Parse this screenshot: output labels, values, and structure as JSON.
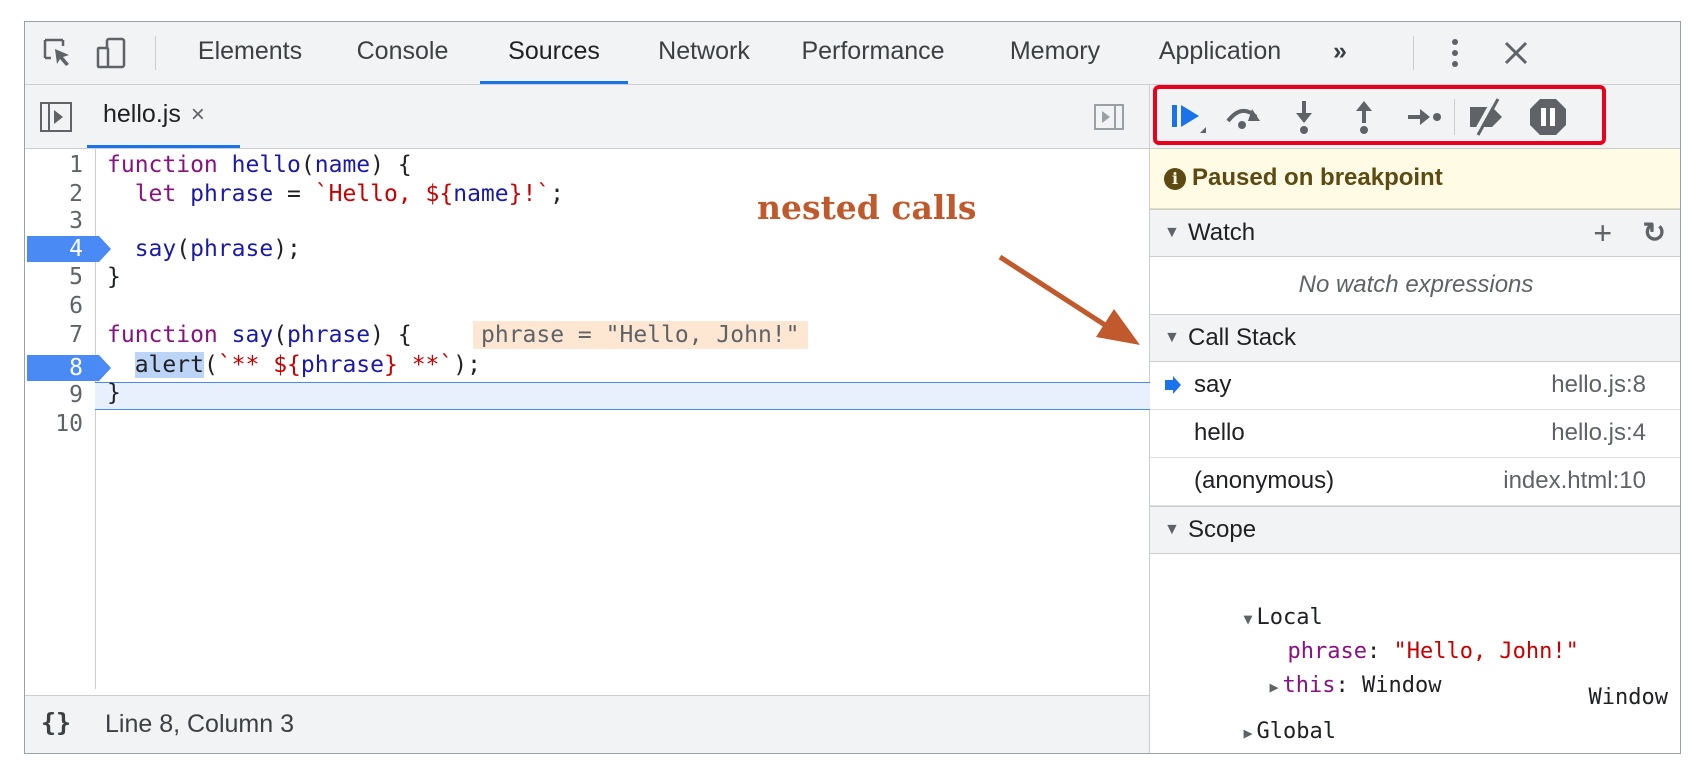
{
  "tabs": {
    "items": [
      {
        "label": "Elements"
      },
      {
        "label": "Console"
      },
      {
        "label": "Sources",
        "active": true
      },
      {
        "label": "Network"
      },
      {
        "label": "Performance"
      },
      {
        "label": "Memory"
      },
      {
        "label": "Application"
      }
    ],
    "more": "»"
  },
  "editor": {
    "file_tab": "hello.js",
    "file_close": "×",
    "inline_value": "phrase = \"Hello, John!\"",
    "line_numbers": [
      "1",
      "2",
      "3",
      "4",
      "5",
      "6",
      "7",
      "8",
      "9",
      "10"
    ],
    "breakpoint_lines": [
      4,
      8
    ],
    "current_line": 8,
    "status_pretty": "{}",
    "status_position": "Line 8, Column 3"
  },
  "code_lines": [
    "function hello(name) {",
    "  let phrase = `Hello, ${name}!`;",
    "",
    "  say(phrase);",
    "}",
    "",
    "function say(phrase) {",
    "  alert(`** ${phrase} **`);",
    "}",
    ""
  ],
  "annotation": {
    "text": "nested calls",
    "color": "#c0592b"
  },
  "debugger": {
    "paused_message": "Paused on breakpoint",
    "watch": {
      "title": "Watch",
      "add": "+",
      "refresh": "↻",
      "empty": "No watch expressions"
    },
    "call_stack": {
      "title": "Call Stack",
      "frames": [
        {
          "name": "say",
          "location": "hello.js:8",
          "current": true
        },
        {
          "name": "hello",
          "location": "hello.js:4"
        },
        {
          "name": "(anonymous)",
          "location": "index.html:10"
        }
      ]
    },
    "scope": {
      "title": "Scope",
      "local_label": "Local",
      "local_props": [
        {
          "name": "phrase",
          "value": "\"Hello, John!\""
        },
        {
          "name": "this",
          "value": "Window"
        }
      ],
      "global_label": "Global",
      "global_value": "Window"
    }
  },
  "colors": {
    "accent": "#1a73e8",
    "breakpoint": "#4a8af4",
    "highlight_box": "#e8001c",
    "paused_bg": "#fffbe5"
  }
}
